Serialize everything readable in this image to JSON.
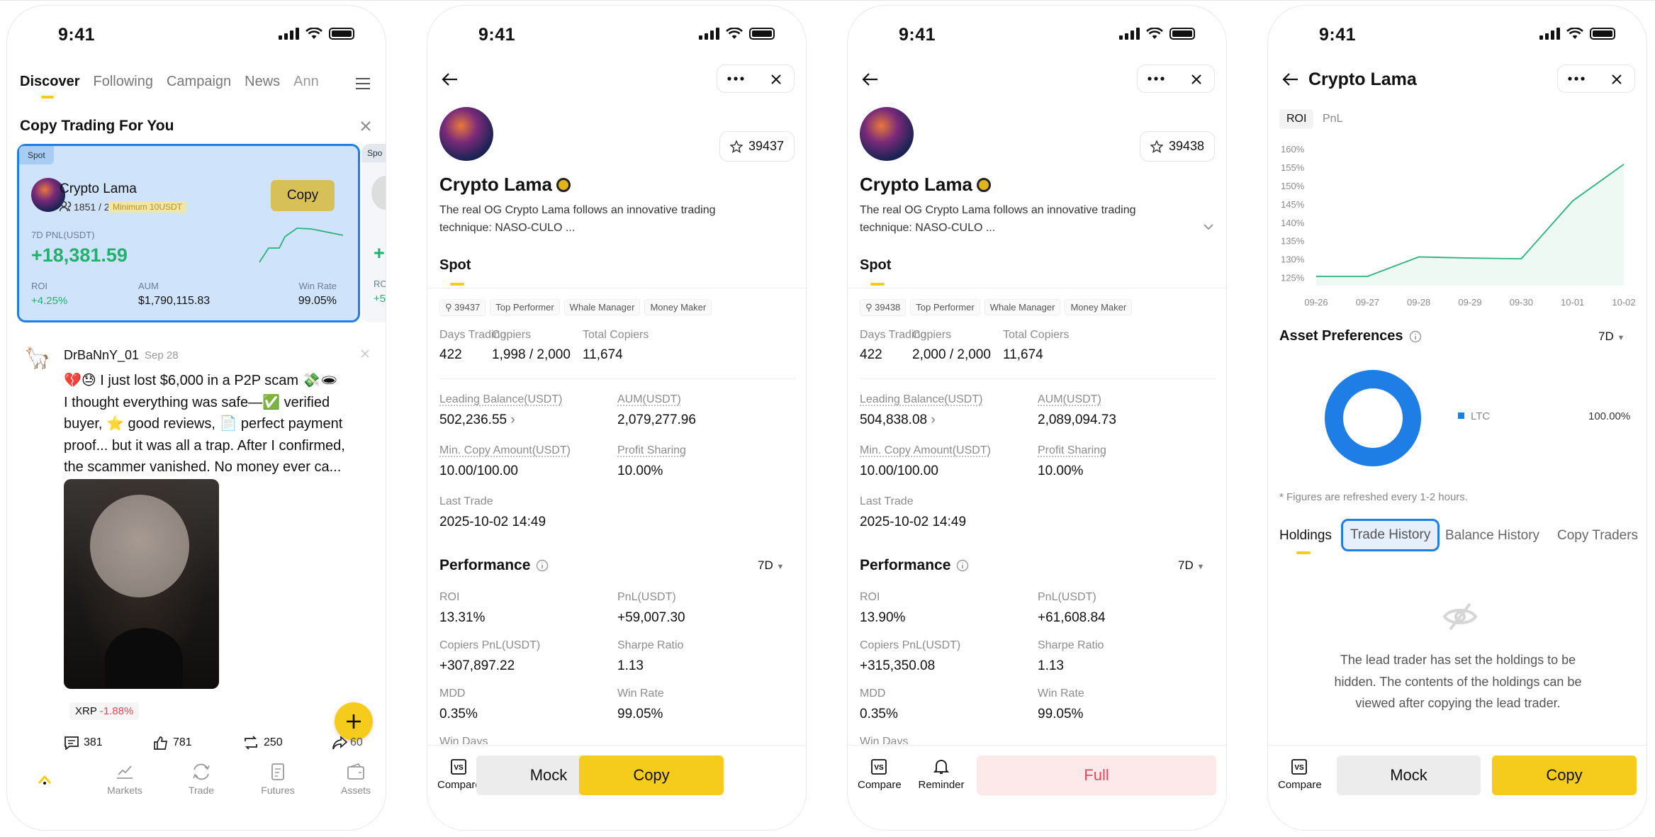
{
  "status_time": "9:41",
  "screen1": {
    "tabs": [
      "Discover",
      "Following",
      "Campaign",
      "News",
      "Ann"
    ],
    "section_title": "Copy Trading For You",
    "card": {
      "badge": "Spot",
      "name": "Crypto Lama",
      "copiers": "1851 / 2000",
      "minimum": "Minimum 10USDT",
      "copy_label": "Copy",
      "pnl_label": "7D PNL(USDT)",
      "pnl_value": "+18,381.59",
      "roi_label": "ROI",
      "roi_value": "+4.25%",
      "aum_label": "AUM",
      "aum_value": "$1,790,115.83",
      "winrate_label": "Win Rate",
      "winrate_value": "99.05%"
    },
    "peek_card": {
      "badge": "Spo",
      "pnl_value": "+1",
      "roi_label": "ROI",
      "roi_value": "+5."
    },
    "post": {
      "username": "DrBaNnY_01",
      "date": "Sep 28",
      "line1": "💔😓 I just lost $6,000 in a P2P scam 💸🕳",
      "line2": "I thought everything was safe—✅ verified",
      "line3": "buyer, ⭐ good reviews, 📄 perfect payment",
      "line4": "proof... but it was all a trap. After I confirmed,",
      "line5": "the scammer vanished. No money ever ca...",
      "ticker": "XRP",
      "ticker_change": "-1.88%",
      "comments": "381",
      "likes": "781",
      "reposts": "250",
      "shares": "60"
    },
    "nav": [
      "Markets",
      "Trade",
      "Futures",
      "Assets"
    ]
  },
  "trader": {
    "name": "Crypto Lama",
    "bio_line1": "The real OG Crypto Lama follows an innovative trading",
    "bio_line2": "technique: NASO-CULO ...",
    "spot_tab": "Spot",
    "tags": [
      "Top Performer",
      "Whale Manager",
      "Money Maker"
    ],
    "labels": {
      "days_trading": "Days Trading",
      "copiers": "Copiers",
      "total_copiers": "Total Copiers",
      "leading_balance": "Leading Balance(USDT)",
      "aum": "AUM(USDT)",
      "min_copy": "Min. Copy Amount(USDT)",
      "profit_sharing": "Profit Sharing",
      "last_trade": "Last Trade",
      "performance": "Performance",
      "period": "7D",
      "roi": "ROI",
      "pnl": "PnL(USDT)",
      "copiers_pnl": "Copiers PnL(USDT)",
      "sharpe": "Sharpe Ratio",
      "mdd": "MDD",
      "win_rate": "Win Rate",
      "win_days": "Win Days"
    },
    "actions": {
      "compare": "Compare",
      "reminder": "Reminder",
      "mock": "Mock",
      "copy": "Copy",
      "full": "Full"
    }
  },
  "screen2": {
    "stars": "39437",
    "followers": "39437",
    "days_trading": "422",
    "copiers": "1,998 / 2,000",
    "total_copiers": "11,674",
    "leading_balance": "502,236.55",
    "aum": "2,079,277.96",
    "min_copy": "10.00/100.00",
    "profit_sharing": "10.00%",
    "last_trade": "2025-10-02 14:49",
    "roi": "13.31%",
    "pnl": "+59,007.30",
    "copiers_pnl": "+307,897.22",
    "sharpe": "1.13",
    "mdd": "0.35%",
    "win_rate": "99.05%"
  },
  "screen3": {
    "stars": "39438",
    "followers": "39438",
    "days_trading": "422",
    "copiers": "2,000 / 2,000",
    "total_copiers": "11,674",
    "leading_balance": "504,838.08",
    "aum": "2,089,094.73",
    "min_copy": "10.00/100.00",
    "profit_sharing": "10.00%",
    "last_trade": "2025-10-02 14:49",
    "roi": "13.90%",
    "pnl": "+61,608.84",
    "copiers_pnl": "+315,350.08",
    "sharpe": "1.13",
    "mdd": "0.35%",
    "win_rate": "99.05%"
  },
  "screen4": {
    "title": "Crypto Lama",
    "chart_tabs": [
      "ROI",
      "PnL"
    ],
    "asset_prefs": "Asset Preferences",
    "period": "7D",
    "legend_asset": "LTC",
    "legend_value": "100.00%",
    "refresh_note": "* Figures are refreshed every 1-2 hours.",
    "tabs": [
      "Holdings",
      "Trade History",
      "Balance History",
      "Copy Traders"
    ],
    "hidden_line1": "The lead trader has set the holdings to be",
    "hidden_line2": "hidden. The contents of the holdings can be",
    "hidden_line3": "viewed after copying the lead trader."
  },
  "colors": {
    "accent": "#f5cc1b",
    "green": "#20b26c",
    "red": "#f0455b",
    "blue": "#1f7de6",
    "card_bg": "#cfe3fb"
  },
  "chart_data": {
    "type": "line",
    "title": "",
    "xlabel": "",
    "ylabel": "",
    "categories": [
      "09-26",
      "09-27",
      "09-28",
      "09-29",
      "09-30",
      "10-01",
      "10-02"
    ],
    "y_ticks": [
      "160%",
      "155%",
      "150%",
      "145%",
      "140%",
      "135%",
      "130%",
      "125%"
    ],
    "ylim": [
      123,
      160
    ],
    "x": [
      "09-26",
      "09-27",
      "09-28",
      "09-29",
      "09-30",
      "10-01",
      "10-02"
    ],
    "series": [
      {
        "values": [
          125.5,
          125.5,
          130.8,
          130.5,
          130.3,
          146,
          156
        ]
      }
    ],
    "grid": false
  }
}
